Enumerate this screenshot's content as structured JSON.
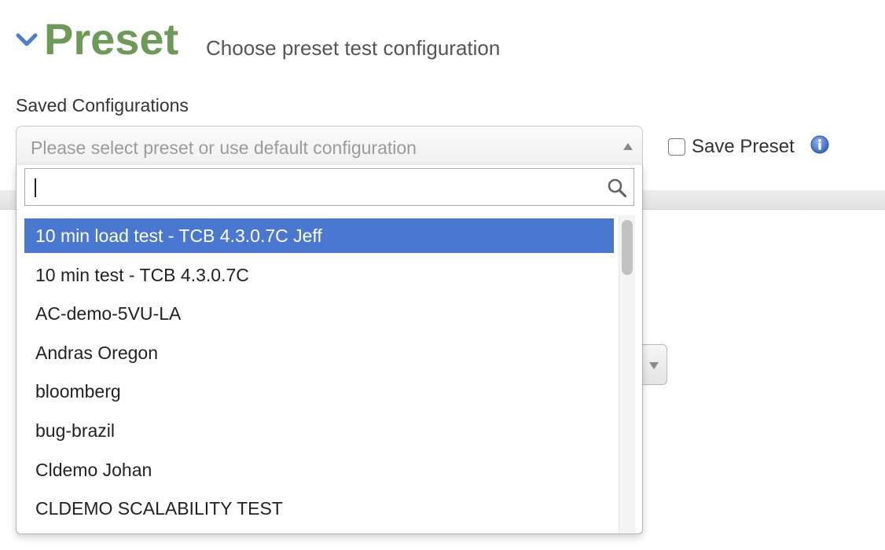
{
  "header": {
    "title": "Preset",
    "subtitle": "Choose preset test configuration"
  },
  "saved_configurations": {
    "label": "Saved Configurations",
    "placeholder": "Please select preset or use default configuration"
  },
  "save_preset": {
    "label": "Save Preset",
    "checked": false
  },
  "dropdown": {
    "search_value": "",
    "highlighted_index": 0,
    "items": [
      "10 min load test - TCB 4.3.0.7C Jeff",
      "10 min test - TCB 4.3.0.7C",
      "AC-demo-5VU-LA",
      "Andras Oregon",
      "bloomberg",
      "bug-brazil",
      "Cldemo Johan",
      "CLDEMO SCALABILITY TEST"
    ]
  },
  "colors": {
    "title": "#6e9a58",
    "chevron": "#4a7fd1",
    "highlight": "#4a78d0",
    "info_icon": "#3d6fc9"
  },
  "icons": {
    "collapse": "chevron-down-icon",
    "info": "info-icon",
    "search": "search-icon",
    "select_arrow": "caret-up-icon"
  }
}
